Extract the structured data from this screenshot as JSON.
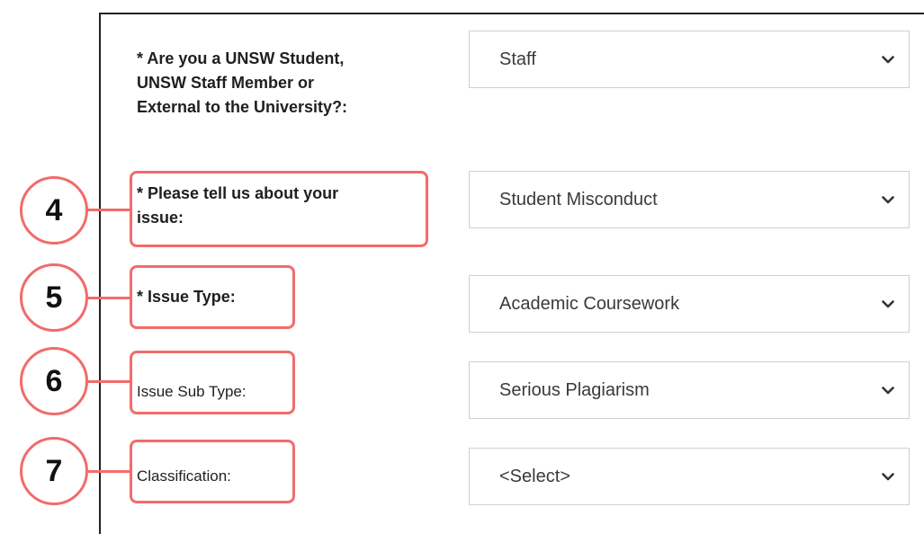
{
  "form": {
    "q1": {
      "label_lines": [
        "* Are you a UNSW Student,",
        "UNSW Staff Member or",
        "External to the University?:"
      ],
      "value": "Staff"
    },
    "q2": {
      "label_lines": [
        "* Please tell us about your",
        "issue:"
      ],
      "value": "Student Misconduct",
      "step": "4"
    },
    "q3": {
      "label": "* Issue Type:",
      "value": "Academic Coursework",
      "step": "5"
    },
    "q4": {
      "label": "Issue Sub Type:",
      "value": "Serious Plagiarism",
      "step": "6"
    },
    "q5": {
      "label": "Classification:",
      "value": "<Select>",
      "step": "7"
    }
  },
  "icons": {
    "dropdown": "chevron-down-icon",
    "step_marker": "numbered-circle-callout"
  },
  "colors": {
    "highlight": "#f26b6b",
    "border": "#222222",
    "select_border": "#cfcfcf",
    "text": "#1f1f1f"
  }
}
